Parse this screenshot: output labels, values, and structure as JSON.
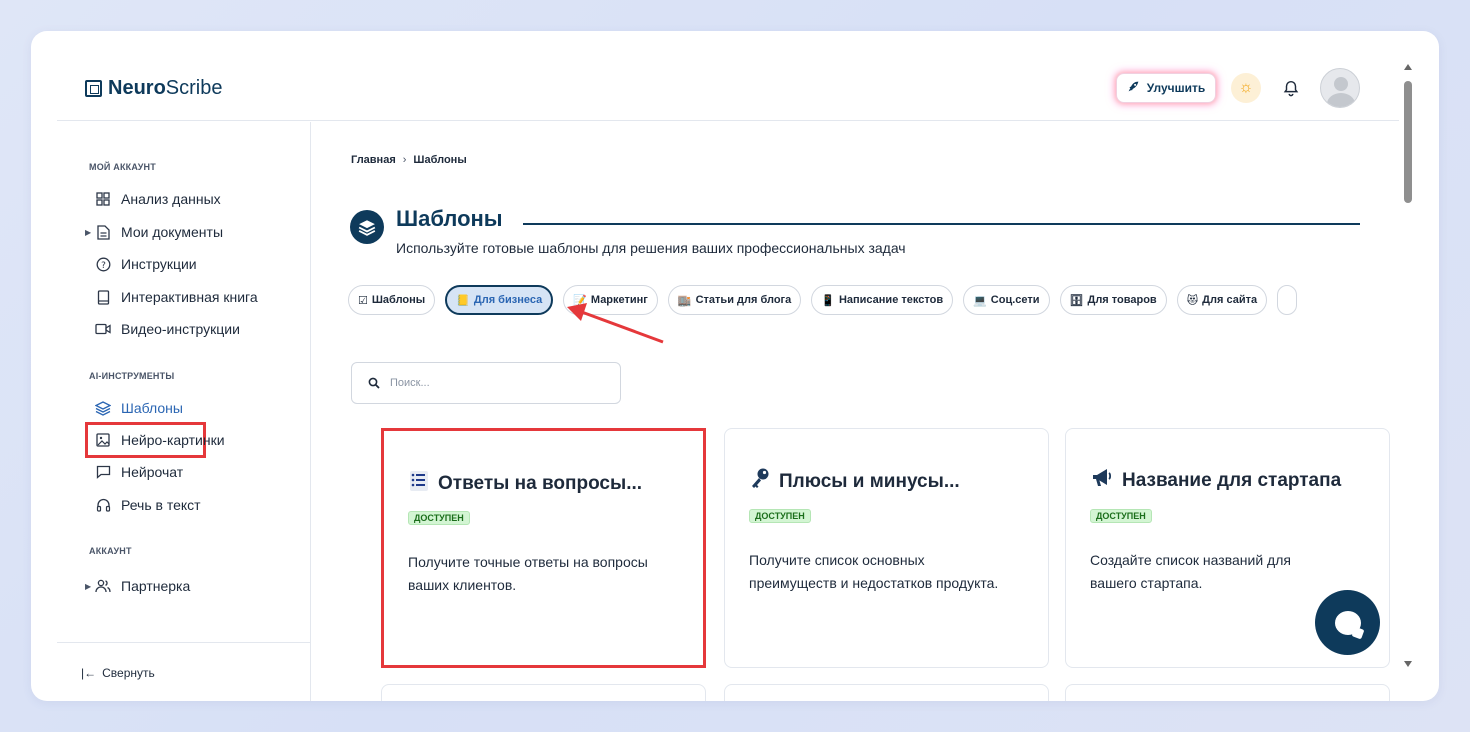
{
  "header": {
    "logo_bold": "Neuro",
    "logo_rest": "Scribe",
    "upgrade_label": "Улучшить"
  },
  "sidebar": {
    "sections": [
      {
        "title": "МОЙ АККАУНТ"
      },
      {
        "title": "AI-ИНСТРУМЕНТЫ"
      },
      {
        "title": "АККАУНТ"
      }
    ],
    "items": [
      {
        "label": "Анализ данных",
        "icon": "grid-icon"
      },
      {
        "label": "Мои документы",
        "icon": "document-icon"
      },
      {
        "label": "Инструкции",
        "icon": "help-circle-icon"
      },
      {
        "label": "Интерактивная книга",
        "icon": "book-icon"
      },
      {
        "label": "Видео-инструкции",
        "icon": "video-icon"
      },
      {
        "label": "Шаблоны",
        "icon": "layers-icon",
        "active": true
      },
      {
        "label": "Нейро-картинки",
        "icon": "image-icon"
      },
      {
        "label": "Нейрочат",
        "icon": "chat-icon"
      },
      {
        "label": "Речь в текст",
        "icon": "headphones-icon"
      },
      {
        "label": "Партнерка",
        "icon": "users-icon"
      }
    ],
    "collapse_label": "Свернуть"
  },
  "main": {
    "breadcrumb": [
      "Главная",
      "Шаблоны"
    ],
    "title": "Шаблоны",
    "subtitle": "Используйте готовые шаблоны для решения ваших профессиональных задач",
    "chips": [
      {
        "label": "Шаблоны",
        "emoji": "☑"
      },
      {
        "label": "Для бизнеса",
        "emoji": "📒",
        "active": true
      },
      {
        "label": "Маркетинг",
        "emoji": "📝"
      },
      {
        "label": "Статьи для блога",
        "emoji": "🏬"
      },
      {
        "label": "Написание текстов",
        "emoji": "📱"
      },
      {
        "label": "Соц.сети",
        "emoji": "💻"
      },
      {
        "label": "Для товаров",
        "emoji": "🗄"
      },
      {
        "label": "Для сайта",
        "emoji": "😻"
      }
    ],
    "search_placeholder": "Поиск...",
    "cards": [
      {
        "title": "Ответы на вопросы...",
        "icon": "list-icon",
        "badge": "ДОСТУПЕН",
        "desc": "Получите точные ответы на вопросы ваших клиентов."
      },
      {
        "title": "Плюсы и минусы...",
        "icon": "key-icon",
        "badge": "ДОСТУПЕН",
        "desc": "Получите список основных преимуществ и недостатков продукта."
      },
      {
        "title": "Название для стартапа",
        "icon": "megaphone-icon",
        "badge": "ДОСТУПЕН",
        "desc": "Создайте список названий для вашего стартапа."
      }
    ]
  },
  "colors": {
    "brand": "#0e3a5b",
    "accent": "#2b66b3",
    "highlight": "#e5383b",
    "badge_bg": "#d3f5d3"
  }
}
